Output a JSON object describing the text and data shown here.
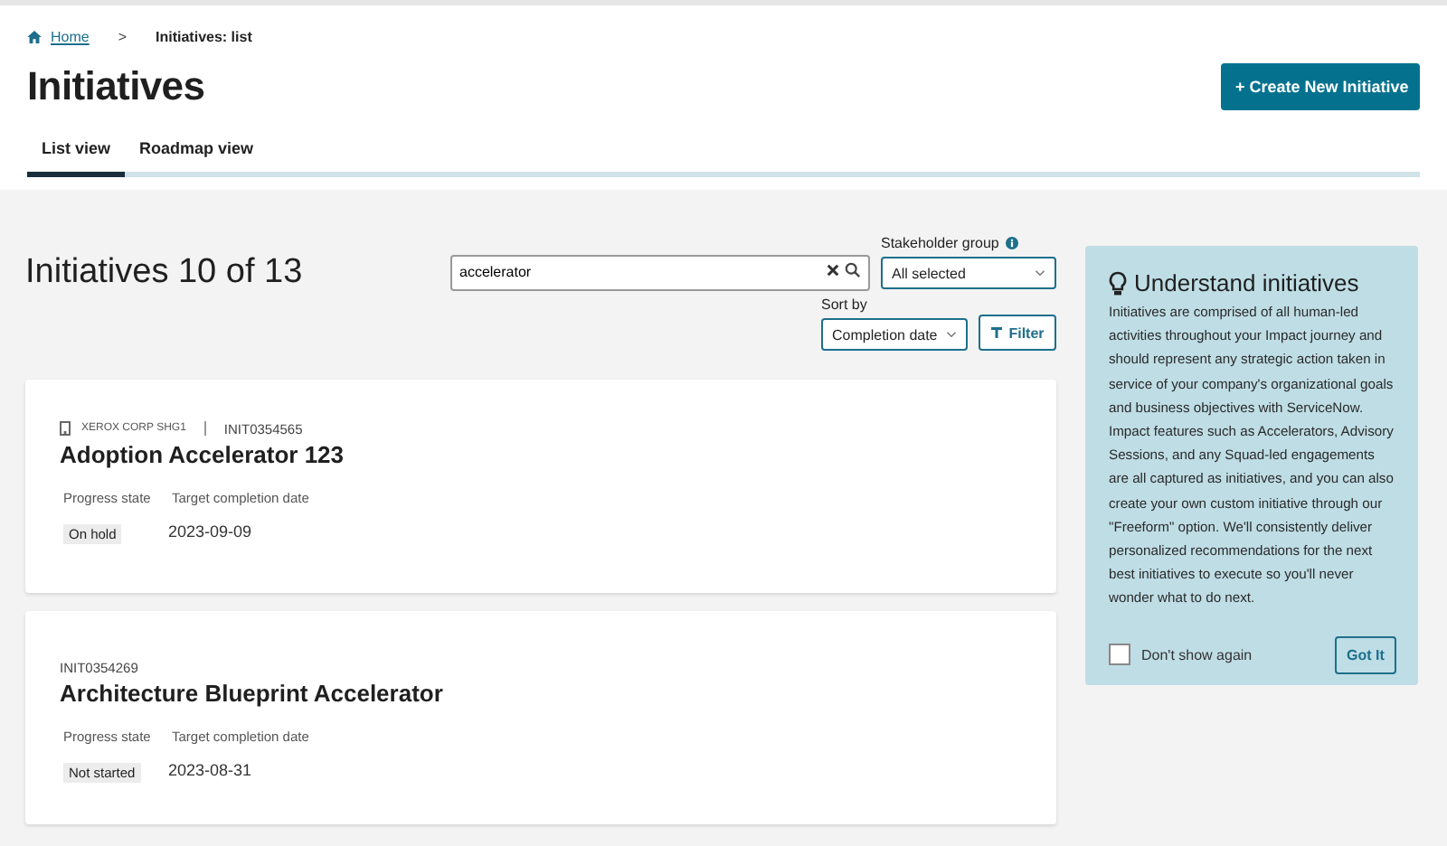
{
  "breadcrumb": {
    "home": "Home",
    "separator": ">",
    "current": "Initiatives: list"
  },
  "page_title": "Initiatives",
  "create_button": {
    "icon": "+",
    "label": "Create New Initiative"
  },
  "tabs": [
    {
      "label": "List view",
      "selected": true
    },
    {
      "label": "Roadmap view",
      "selected": false
    }
  ],
  "list_heading": "Initiatives 10 of 13",
  "search": {
    "value": "accelerator"
  },
  "stakeholder_group": {
    "label": "Stakeholder group",
    "value": "All selected"
  },
  "sort_by": {
    "label": "Sort by",
    "value": "Completion date"
  },
  "filter_button": "Filter",
  "initiatives": [
    {
      "account": "XEROX CORP SHG1",
      "number": "INIT0354565",
      "title": "Adoption Accelerator 123",
      "progress_label": "Progress state",
      "progress": "On hold",
      "date_label": "Target completion date",
      "date": "2023-09-09"
    },
    {
      "number": "INIT0354269",
      "title": "Architecture Blueprint Accelerator",
      "progress_label": "Progress state",
      "progress": "Not started",
      "date_label": "Target completion date",
      "date": "2023-08-31"
    }
  ],
  "info_panel": {
    "title": "Understand initiatives",
    "body": "Initiatives are comprised of all human-led activities throughout your Impact journey and should represent any strategic action taken in service of your company's organizational goals and business objectives with ServiceNow. Impact features such as Accelerators, Advisory Sessions, and any Squad-led engagements are all captured as initiatives, and you can also create your own custom initiative through our \"Freeform\" option. We'll consistently deliver personalized recommendations for the next best initiatives to execute so you'll never wonder what to do next.",
    "dont_show_again": {
      "label": "Don't show again",
      "checked": false
    },
    "button": "Got It"
  }
}
